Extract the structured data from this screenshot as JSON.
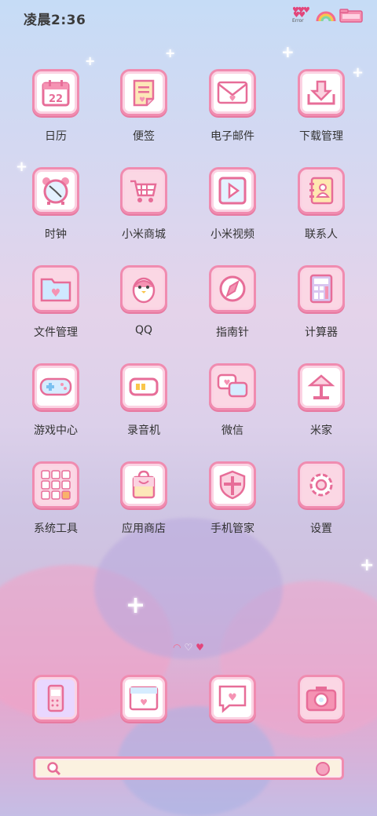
{
  "status_bar": {
    "time": "凌晨2:36",
    "battery_text": "Error"
  },
  "apps": [
    {
      "label": "日历",
      "icon": "calendar-icon",
      "date": "22"
    },
    {
      "label": "便签",
      "icon": "notes-icon"
    },
    {
      "label": "电子邮件",
      "icon": "mail-icon"
    },
    {
      "label": "下载管理",
      "icon": "download-icon"
    },
    {
      "label": "时钟",
      "icon": "clock-icon"
    },
    {
      "label": "小米商城",
      "icon": "cart-icon"
    },
    {
      "label": "小米视频",
      "icon": "video-icon"
    },
    {
      "label": "联系人",
      "icon": "contacts-icon"
    },
    {
      "label": "文件管理",
      "icon": "folder-icon"
    },
    {
      "label": "QQ",
      "icon": "penguin-icon"
    },
    {
      "label": "指南针",
      "icon": "compass-icon"
    },
    {
      "label": "计算器",
      "icon": "calculator-icon"
    },
    {
      "label": "游戏中心",
      "icon": "gamepad-icon"
    },
    {
      "label": "录音机",
      "icon": "recorder-icon"
    },
    {
      "label": "微信",
      "icon": "chat-icon"
    },
    {
      "label": "米家",
      "icon": "lamp-icon"
    },
    {
      "label": "系统工具",
      "icon": "tools-folder-icon"
    },
    {
      "label": "应用商店",
      "icon": "shopping-bag-icon"
    },
    {
      "label": "手机管家",
      "icon": "shield-icon"
    },
    {
      "label": "设置",
      "icon": "gear-icon"
    }
  ],
  "dock": [
    {
      "icon": "phone-icon"
    },
    {
      "icon": "browser-icon"
    },
    {
      "icon": "message-icon"
    },
    {
      "icon": "camera-icon"
    }
  ],
  "colors": {
    "accent": "#f08cb0",
    "tile_bg": "#ffffff",
    "label": "#333333"
  }
}
